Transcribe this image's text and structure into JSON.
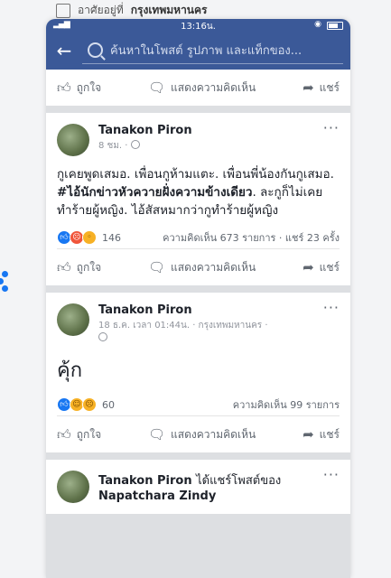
{
  "background": {
    "location_prefix": "อาศัยอยู่ที่",
    "location_city": "กรุงเทพมหานคร"
  },
  "status_bar": {
    "time": "13:16น."
  },
  "search": {
    "placeholder": "ค้นหาในโพสต์ รูปภาพ และแท็กของ..."
  },
  "actions": {
    "like": "ถูกใจ",
    "comment": "แสดงความคิดเห็น",
    "share": "แชร์"
  },
  "posts": [
    {
      "author": "Tanakon Piron",
      "time": "8 ชม. ·",
      "text_before": "กูเคยพูดเสมอ. เพื่อนกูห้ามแตะ. เพื่อนพี่น้องกันกูเสมอ. ",
      "text_bold": "#ไอ้นักข่าวหัวควายฝั่งความข้างเดียว",
      "text_after": ". ละกูก็ไม่เคยทำร้ายผู้หญิง. ไอ้สัสหมากว่ากูทำร้ายผู้หญิง",
      "reactions_count": "146",
      "comments": "ความคิดเห็น 673 รายการ",
      "shares": "แชร์ 23 ครั้ง"
    },
    {
      "author": "Tanakon Piron",
      "time": "18 ธ.ค. เวลา 01:44น. · กรุงเทพมหานคร ·",
      "text": "คุ้ก",
      "reactions_count": "60",
      "comments": "ความคิดเห็น 99 รายการ"
    },
    {
      "author": "Tanakon Piron",
      "shared_text": "ได้แชร์โพสต์ของ",
      "shared_from": "Napatchara Zindy"
    }
  ]
}
